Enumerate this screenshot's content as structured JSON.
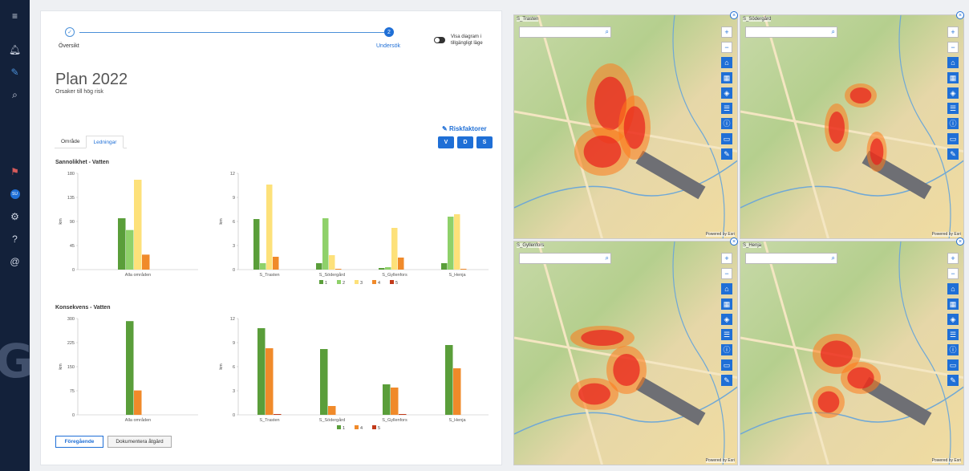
{
  "rail": {
    "icons": [
      "menu-icon",
      "bell-icon",
      "edit-icon",
      "search-icon",
      "flag-icon",
      "user-badge-icon",
      "gear-icon",
      "help-icon",
      "at-icon"
    ],
    "badge": "SU"
  },
  "stepper": {
    "step1": "Översikt",
    "step2": "Undersök",
    "step2_num": "2",
    "toggle_label": "Visa diagram i tillgängligt läge"
  },
  "page": {
    "title": "Plan 2022",
    "subtitle": "Orsaker till hög risk"
  },
  "tabs": [
    {
      "label": "Område"
    },
    {
      "label": "Ledningar"
    }
  ],
  "riskfaktorer": {
    "label": "Riskfaktorer",
    "buttons": [
      "V",
      "D",
      "S"
    ]
  },
  "colors": {
    "c1": "#5a9e3a",
    "c2": "#8fd16a",
    "c3": "#fde17a",
    "c4": "#f08a2a",
    "c5": "#c23a1a"
  },
  "chart_data": [
    {
      "type": "bar",
      "title": "Sannolikhet - Vatten",
      "ylabel": "km",
      "ylim": [
        0,
        180
      ],
      "yticks": [
        0,
        45,
        90,
        135,
        180
      ],
      "categories": [
        "Alla områden"
      ],
      "series": [
        {
          "name": "1",
          "values": [
            96
          ]
        },
        {
          "name": "2",
          "values": [
            74
          ]
        },
        {
          "name": "3",
          "values": [
            168
          ]
        },
        {
          "name": "4",
          "values": [
            28
          ]
        },
        {
          "name": "5",
          "values": [
            0
          ]
        }
      ]
    },
    {
      "type": "bar",
      "ylabel": "km",
      "ylim": [
        0,
        12
      ],
      "yticks": [
        0,
        3,
        6,
        9,
        12
      ],
      "categories": [
        "S_Trasten",
        "S_Södergård",
        "S_Gyllenfors",
        "S_Henja"
      ],
      "series": [
        {
          "name": "1",
          "values": [
            6.3,
            0.8,
            0.2,
            0.8
          ]
        },
        {
          "name": "2",
          "values": [
            0.8,
            6.4,
            0.3,
            6.6
          ]
        },
        {
          "name": "3",
          "values": [
            10.6,
            1.8,
            5.2,
            6.9
          ]
        },
        {
          "name": "4",
          "values": [
            1.6,
            0.1,
            1.5,
            0.1
          ]
        },
        {
          "name": "5",
          "values": [
            0,
            0,
            0,
            0
          ]
        }
      ],
      "legend": [
        "1",
        "2",
        "3",
        "4",
        "5"
      ]
    },
    {
      "type": "bar",
      "title": "Konsekvens - Vatten",
      "ylabel": "km",
      "ylim": [
        0,
        300
      ],
      "yticks": [
        0,
        75,
        150,
        225,
        300
      ],
      "categories": [
        "Alla områden"
      ],
      "series": [
        {
          "name": "1",
          "values": [
            292
          ]
        },
        {
          "name": "4",
          "values": [
            76
          ]
        },
        {
          "name": "5",
          "values": [
            0
          ]
        }
      ]
    },
    {
      "type": "bar",
      "ylabel": "km",
      "ylim": [
        0,
        12
      ],
      "yticks": [
        0,
        3,
        6,
        9,
        12
      ],
      "categories": [
        "S_Trasten",
        "S_Södergård",
        "S_Gyllenfors",
        "S_Henja"
      ],
      "series": [
        {
          "name": "1",
          "values": [
            10.8,
            8.2,
            3.8,
            8.7
          ]
        },
        {
          "name": "4",
          "values": [
            8.3,
            1.1,
            3.4,
            5.8
          ]
        },
        {
          "name": "5",
          "values": [
            0.1,
            0,
            0.1,
            0
          ]
        }
      ],
      "legend": [
        "1",
        "4",
        "5"
      ]
    }
  ],
  "buttons": {
    "prev": "Föregående",
    "doc": "Dokumentera åtgärd"
  },
  "maps": [
    {
      "label": "S_Trasten",
      "powered": "Powered by Esri"
    },
    {
      "label": "S_Södergård",
      "powered": "Powered by Esri"
    },
    {
      "label": "S_Gyllenfors",
      "powered": "Powered by Esri"
    },
    {
      "label": "S_Henja",
      "powered": "Powered by Esri"
    }
  ]
}
